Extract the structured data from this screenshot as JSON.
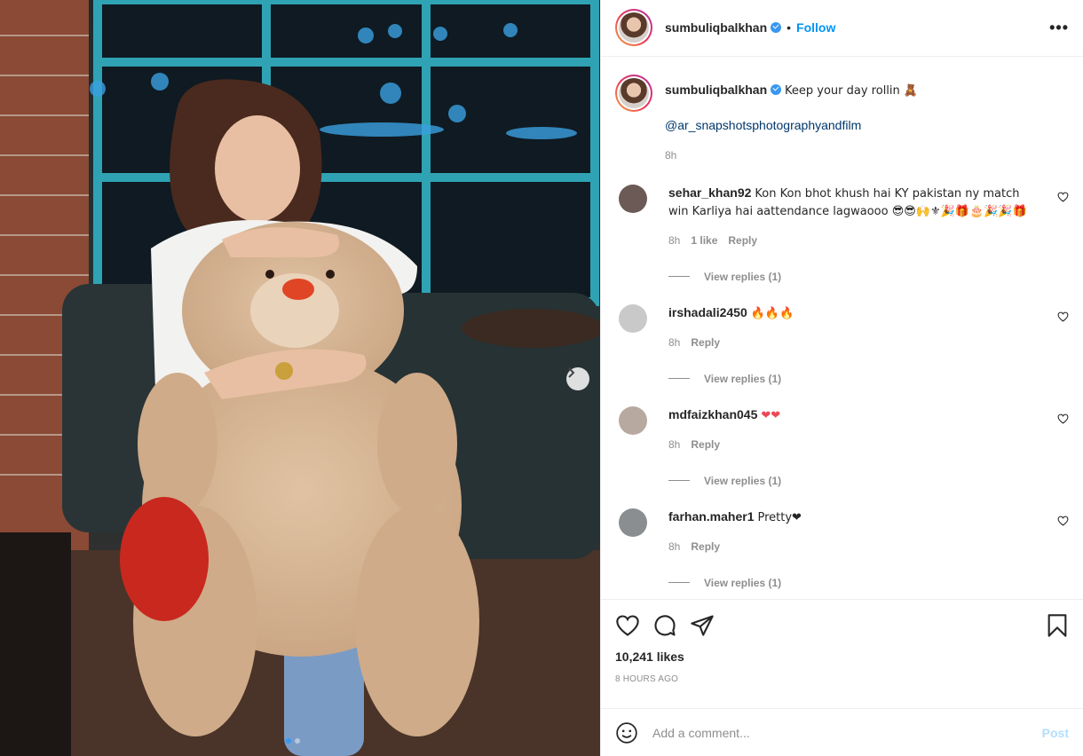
{
  "header": {
    "username": "sumbuliqbalkhan",
    "follow_label": "Follow",
    "bullet": "•",
    "more_label": "•••"
  },
  "caption": {
    "username": "sumbuliqbalkhan",
    "text": "Keep your day rollin 🧸",
    "mention": "@ar_snapshotsphotographyandfilm",
    "time": "8h"
  },
  "comments": [
    {
      "username": "sehar_khan92",
      "text": "Kon Kon bhot khush hai KY pakistan ny match win Karliya hai aattendance lagwaooo 😎😎🙌⚜🎉🎁🎂🎉🎉🎁",
      "time": "8h",
      "likes": "1 like",
      "reply": "Reply",
      "view_replies": "View replies (1)",
      "avatar_color": "#6b5a55"
    },
    {
      "username": "irshadali2450",
      "text": "🔥🔥🔥",
      "time": "8h",
      "likes": "",
      "reply": "Reply",
      "view_replies": "View replies (1)",
      "avatar_color": "#c9c9c9"
    },
    {
      "username": "mdfaizkhan045",
      "text": "❤❤",
      "time": "8h",
      "likes": "",
      "reply": "Reply",
      "view_replies": "View replies (1)",
      "avatar_color": "#b8a9a0"
    },
    {
      "username": "farhan.maher1",
      "text": "Pretty❤",
      "time": "8h",
      "likes": "",
      "reply": "Reply",
      "view_replies": "View replies (1)",
      "avatar_color": "#8a8e90"
    }
  ],
  "likes_text": "10,241 likes",
  "posted_ago": "8 HOURS AGO",
  "add_comment": {
    "placeholder": "Add a comment...",
    "post_label": "Post"
  },
  "colors": {
    "accent": "#0095f6",
    "heart": "#ed4956"
  },
  "icons": [
    "heart-icon",
    "comment-icon",
    "share-icon",
    "bookmark-icon",
    "emoji-icon",
    "next-arrow-icon",
    "verified-icon"
  ]
}
